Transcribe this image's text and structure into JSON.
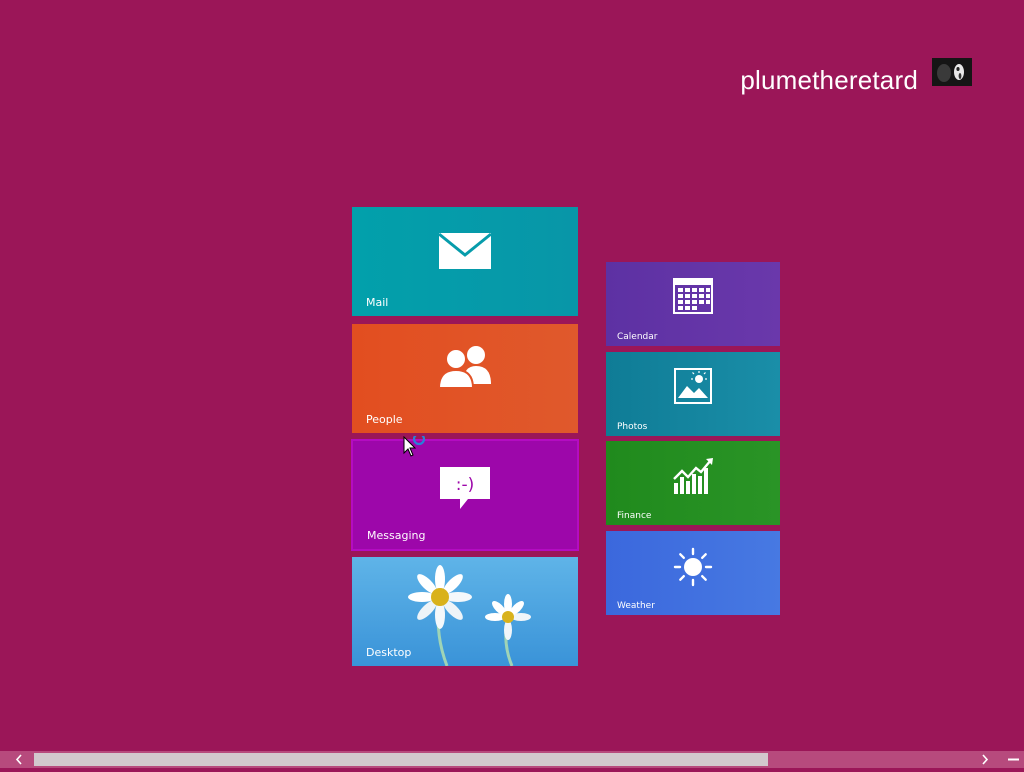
{
  "user": {
    "name": "plumetheretard",
    "avatar_icon": "user-avatar-photo"
  },
  "tiles": {
    "mail": {
      "label": "Mail",
      "icon": "envelope-icon",
      "color": "#02a0ab"
    },
    "people": {
      "label": "People",
      "icon": "people-icon",
      "color": "#e24e20"
    },
    "messaging": {
      "label": "Messaging",
      "icon": "chat-bubble-icon",
      "color": "#9d07aa"
    },
    "desktop": {
      "label": "Desktop",
      "icon": "daisy-wallpaper",
      "color": "#4aa4e0"
    },
    "calendar": {
      "label": "Calendar",
      "icon": "calendar-icon",
      "color": "#5d31a3"
    },
    "photos": {
      "label": "Photos",
      "icon": "picture-icon",
      "color": "#0f7c96"
    },
    "finance": {
      "label": "Finance",
      "icon": "stock-chart-icon",
      "color": "#208a1d"
    },
    "weather": {
      "label": "Weather",
      "icon": "sun-icon",
      "color": "#3b68dd"
    }
  },
  "colors": {
    "background": "#9b1658",
    "scrollbar_track": "#b74a7d",
    "scrollbar_thumb": "#d2c8cd"
  },
  "scrollbar": {
    "left_icon": "chevron-left-icon",
    "right_icon": "chevron-right-icon",
    "zoom_icon": "semantic-zoom-minus-icon"
  }
}
